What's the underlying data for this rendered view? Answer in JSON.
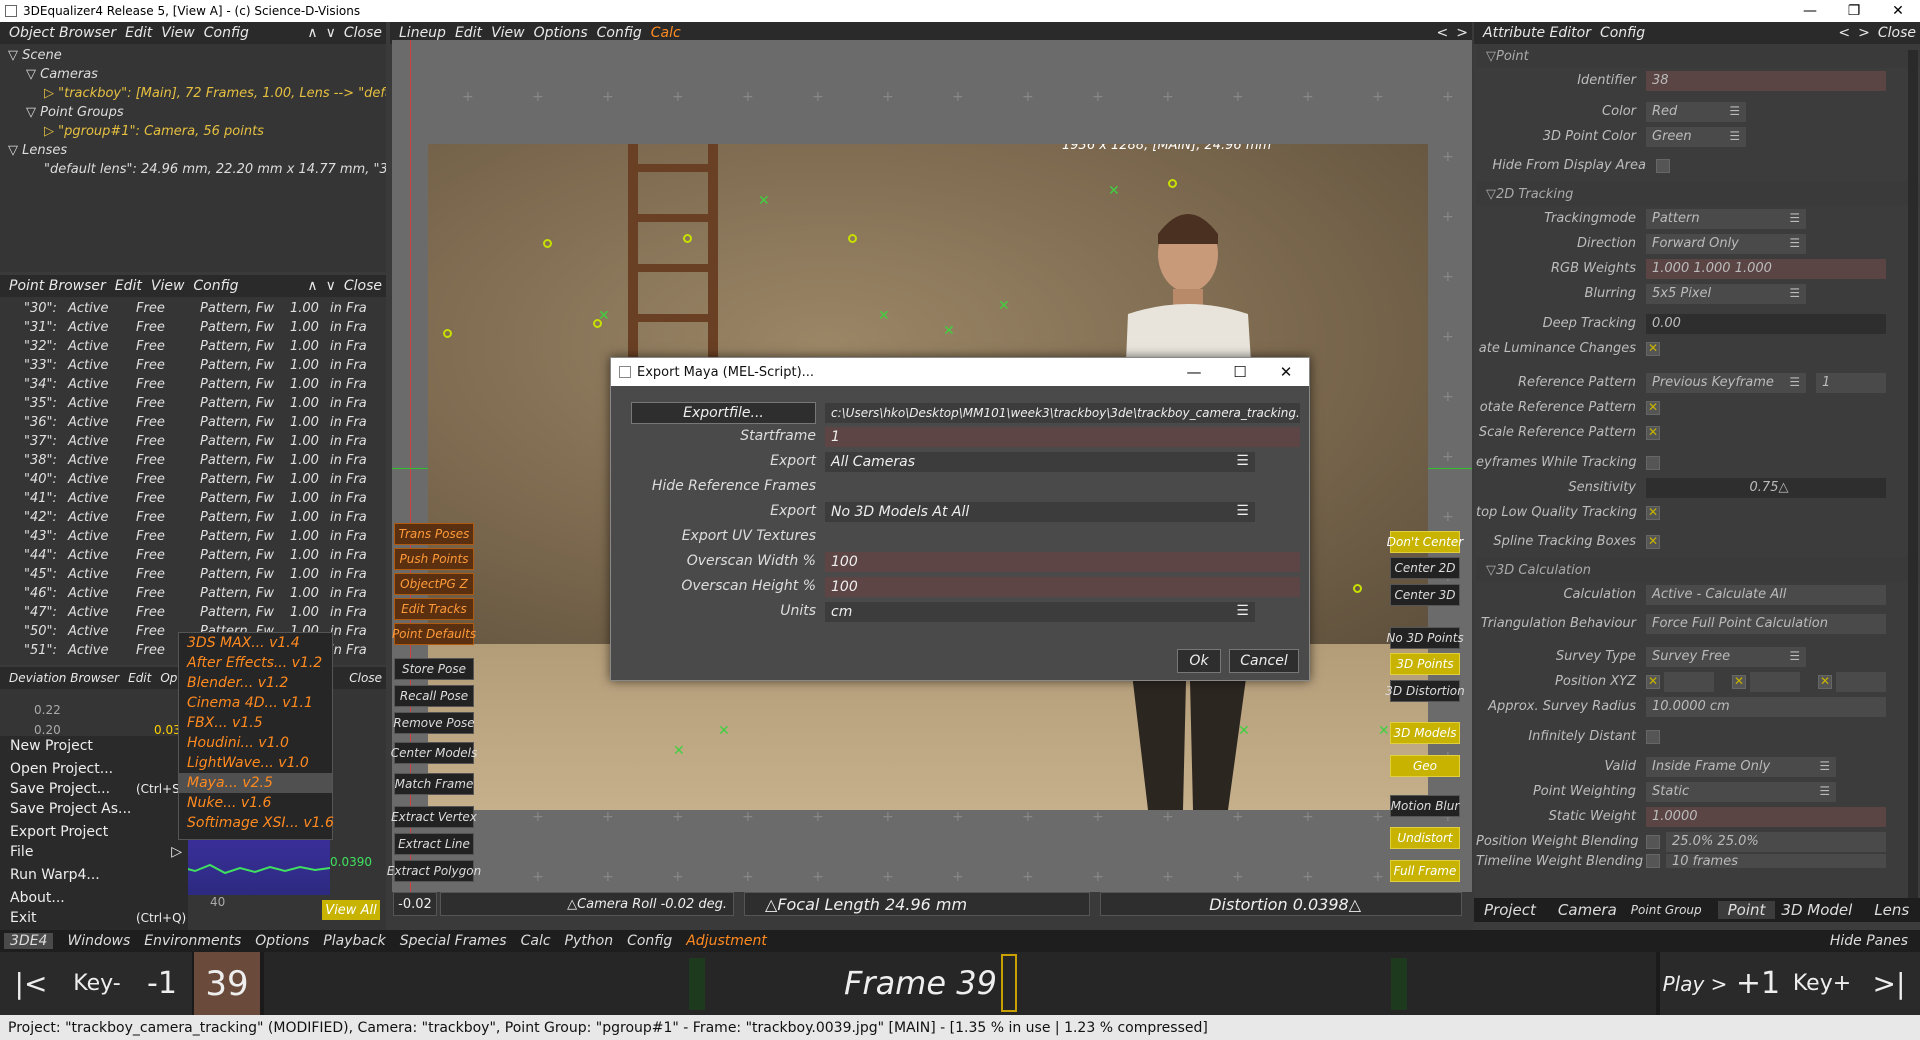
{
  "window": {
    "title": "3DEqualizer4 Release 5, [View A]  -  (c) Science-D-Visions",
    "min": "—",
    "max": "❐",
    "close": "✕"
  },
  "object_browser": {
    "menu": [
      "Object Browser",
      "Edit",
      "View",
      "Config"
    ],
    "close": "Close",
    "tree": {
      "scene": "Scene",
      "cameras": "Cameras",
      "camera_item": "\"trackboy\":  [Main], 72 Frames, 1.00, Lens --> \"defa",
      "point_groups": "Point Groups",
      "pg_item": "\"pgroup#1\":  Camera, 56 points",
      "lenses": "Lenses",
      "lens_item": "\"default lens\":  24.96 mm, 22.20 mm x 14.77 mm, \"3D"
    }
  },
  "point_browser": {
    "menu": [
      "Point Browser",
      "Edit",
      "View",
      "Config"
    ],
    "close": "Close",
    "rows": [
      [
        "\"30\":",
        "Active",
        "Free",
        "Pattern, Fw",
        "1.00",
        "in Fra"
      ],
      [
        "\"31\":",
        "Active",
        "Free",
        "Pattern, Fw",
        "1.00",
        "in Fra"
      ],
      [
        "\"32\":",
        "Active",
        "Free",
        "Pattern, Fw",
        "1.00",
        "in Fra"
      ],
      [
        "\"33\":",
        "Active",
        "Free",
        "Pattern, Fw",
        "1.00",
        "in Fra"
      ],
      [
        "\"34\":",
        "Active",
        "Free",
        "Pattern, Fw",
        "1.00",
        "in Fra"
      ],
      [
        "\"35\":",
        "Active",
        "Free",
        "Pattern, Fw",
        "1.00",
        "in Fra"
      ],
      [
        "\"36\":",
        "Active",
        "Free",
        "Pattern, Fw",
        "1.00",
        "in Fra"
      ],
      [
        "\"37\":",
        "Active",
        "Free",
        "Pattern, Fw",
        "1.00",
        "in Fra"
      ],
      [
        "\"38\":",
        "Active",
        "Free",
        "Pattern, Fw",
        "1.00",
        "in Fra"
      ],
      [
        "\"40\":",
        "Active",
        "Free",
        "Pattern, Fw",
        "1.00",
        "in Fra"
      ],
      [
        "\"41\":",
        "Active",
        "Free",
        "Pattern, Fw",
        "1.00",
        "in Fra"
      ],
      [
        "\"42\":",
        "Active",
        "Free",
        "Pattern, Fw",
        "1.00",
        "in Fra"
      ],
      [
        "\"43\":",
        "Active",
        "Free",
        "Pattern, Fw",
        "1.00",
        "in Fra"
      ],
      [
        "\"44\":",
        "Active",
        "Free",
        "Pattern, Fw",
        "1.00",
        "in Fra"
      ],
      [
        "\"45\":",
        "Active",
        "Free",
        "Pattern, Fw",
        "1.00",
        "in Fra"
      ],
      [
        "\"46\":",
        "Active",
        "Free",
        "Pattern, Fw",
        "1.00",
        "in Fra"
      ],
      [
        "\"47\":",
        "Active",
        "Free",
        "Pattern, Fw",
        "1.00",
        "in Fra"
      ],
      [
        "\"50\":",
        "Active",
        "Free",
        "Pattern, Fw",
        "1.00",
        "in Fra"
      ],
      [
        "\"51\":",
        "Active",
        "Free",
        "Pattern, Fw",
        "1.00",
        "in Fra"
      ]
    ]
  },
  "deviation_browser": {
    "menu": [
      "Deviation Browser",
      "Edit",
      "Opt"
    ],
    "close": "Close",
    "y1": "0.22",
    "y2": "0.20",
    "xval": "40",
    "val1": "0.03",
    "val2": "0.0390",
    "view_all": "View All"
  },
  "lineup": {
    "menu": [
      "Lineup",
      "Edit",
      "View",
      "Options",
      "Config",
      "Calc"
    ],
    "image_info": "1936 x 1288, [MAIN], 24.96 mm",
    "left_buttons": [
      "Trans Poses",
      "Push Points",
      "ObjectPG Z",
      "Edit Tracks",
      "Point Defaults",
      "Store Pose",
      "Recall Pose",
      "Remove Pose",
      "Center Models",
      "Match Frame",
      "Extract Vertex",
      "Extract Line",
      "Extract Polygon"
    ],
    "right_buttons": [
      "Don't Center",
      "Center 2D",
      "Center 3D",
      "No 3D Points",
      "3D Points",
      "3D Distortion",
      "3D Models",
      "Geo",
      "Motion Blur",
      "Undistort",
      "Full Frame"
    ],
    "roll_value": "-0.02",
    "camera_roll": "Camera Roll -0.02 deg.",
    "focal_length": "Focal Length 24.96 mm",
    "distortion": "Distortion 0.0398"
  },
  "attribute_editor": {
    "menu": [
      "Attribute Editor",
      "Config"
    ],
    "close": "Close",
    "sections": {
      "point": "Point",
      "tracking": "2D Tracking",
      "calc": "3D Calculation"
    },
    "identifier": {
      "label": "Identifier",
      "value": "38"
    },
    "color": {
      "label": "Color",
      "value": "Red"
    },
    "point3d_color": {
      "label": "3D Point Color",
      "value": "Green"
    },
    "hide_display": {
      "label": "Hide From Display Area"
    },
    "trackingmode": {
      "label": "Trackingmode",
      "value": "Pattern"
    },
    "direction": {
      "label": "Direction",
      "value": "Forward Only"
    },
    "rgb": {
      "label": "RGB Weights",
      "value": "1.000 1.000 1.000"
    },
    "blurring": {
      "label": "Blurring",
      "value": "5x5 Pixel"
    },
    "deep": {
      "label": "Deep Tracking",
      "value": "0.00"
    },
    "lum": {
      "label": "ate Luminance Changes"
    },
    "refpattern": {
      "label": "Reference Pattern",
      "value": "Previous Keyframe",
      "extra": "1"
    },
    "rotref": {
      "label": "otate Reference Pattern"
    },
    "scaleref": {
      "label": "Scale Reference Pattern"
    },
    "keyframes": {
      "label": "eyframes While Tracking"
    },
    "sensitivity": {
      "label": "Sensitivity",
      "value": "0.75"
    },
    "lowq": {
      "label": "top Low Quality Tracking"
    },
    "spline": {
      "label": "Spline Tracking Boxes"
    },
    "calculation": {
      "label": "Calculation",
      "value": "Active - Calculate All"
    },
    "triang": {
      "label": "Triangulation Behaviour",
      "value": "Force Full Point Calculation"
    },
    "survey": {
      "label": "Survey Type",
      "value": "Survey Free"
    },
    "posxyz": {
      "label": "Position XYZ"
    },
    "radius": {
      "label": "Approx. Survey Radius",
      "value": "10.0000 cm"
    },
    "infinite": {
      "label": "Infinitely Distant"
    },
    "valid": {
      "label": "Valid",
      "value": "Inside Frame Only"
    },
    "pweight": {
      "label": "Point Weighting",
      "value": "Static"
    },
    "sweight": {
      "label": "Static Weight",
      "value": "1.0000"
    },
    "pwblend": {
      "label": "Position Weight Blending",
      "value": "25.0%  25.0%"
    },
    "tlblend": {
      "label": "Timeline Weight Blending",
      "value": "10 frames"
    },
    "tabs": [
      "Project",
      "Camera",
      "Point Group",
      "Point",
      "3D Model",
      "Lens"
    ]
  },
  "main_menu": {
    "items": [
      "3DE4",
      "Windows",
      "Environments",
      "Options",
      "Playback",
      "Special Frames",
      "Calc",
      "Python",
      "Config",
      "Adjustment"
    ],
    "hide_panes": "Hide Panes"
  },
  "timeline": {
    "first": "|<",
    "key_prev": "Key-",
    "minus1": "-1",
    "frame": "39",
    "frame_label": "Frame 39",
    "play": "Play >",
    "plus1": "+1",
    "key_next": "Key+",
    "last": ">|"
  },
  "status": "Project: \"trackboy_camera_tracking\"  (MODIFIED), Camera: \"trackboy\", Point Group: \"pgroup#1\"  -  Frame: \"trackboy.0039.jpg\"  [MAIN]  -  [1.35 % in use | 1.23 % compressed]",
  "file_menu": {
    "items": [
      "New Project",
      "Open Project...",
      "Save Project...",
      "Save Project As...",
      "Export Project",
      "File",
      "Run Warp4...",
      "About...",
      "Exit"
    ],
    "save_shortcut": "(Ctrl+S)",
    "exit_shortcut": "(Ctrl+Q)"
  },
  "export_submenu": [
    "3DS MAX...  v1.4",
    "After Effects...  v1.2",
    "Blender...  v1.2",
    "Cinema 4D...  v1.1",
    "FBX...  v1.5",
    "Houdini...  v1.0",
    "LightWave...  v1.0",
    "Maya...  v2.5",
    "Nuke...  v1.6",
    "Softimage XSI...  v1.6"
  ],
  "dialog": {
    "title": "Export Maya (MEL-Script)...",
    "exportfile_btn": "Exportfile...",
    "exportfile": "c:\\Users\\hko\\Desktop\\MM101\\week3\\trackboy\\3de\\trackboy_camera_tracking.mel",
    "startframe_lbl": "Startframe",
    "startframe": "1",
    "export_lbl": "Export",
    "export": "All Cameras",
    "hide_ref_lbl": "Hide Reference Frames",
    "export2_lbl": "Export",
    "export2": "No 3D Models At All",
    "uv_lbl": "Export UV Textures",
    "ow_lbl": "Overscan Width %",
    "ow": "100",
    "oh_lbl": "Overscan Height %",
    "oh": "100",
    "units_lbl": "Units",
    "units": "cm",
    "ok": "Ok",
    "cancel": "Cancel"
  }
}
